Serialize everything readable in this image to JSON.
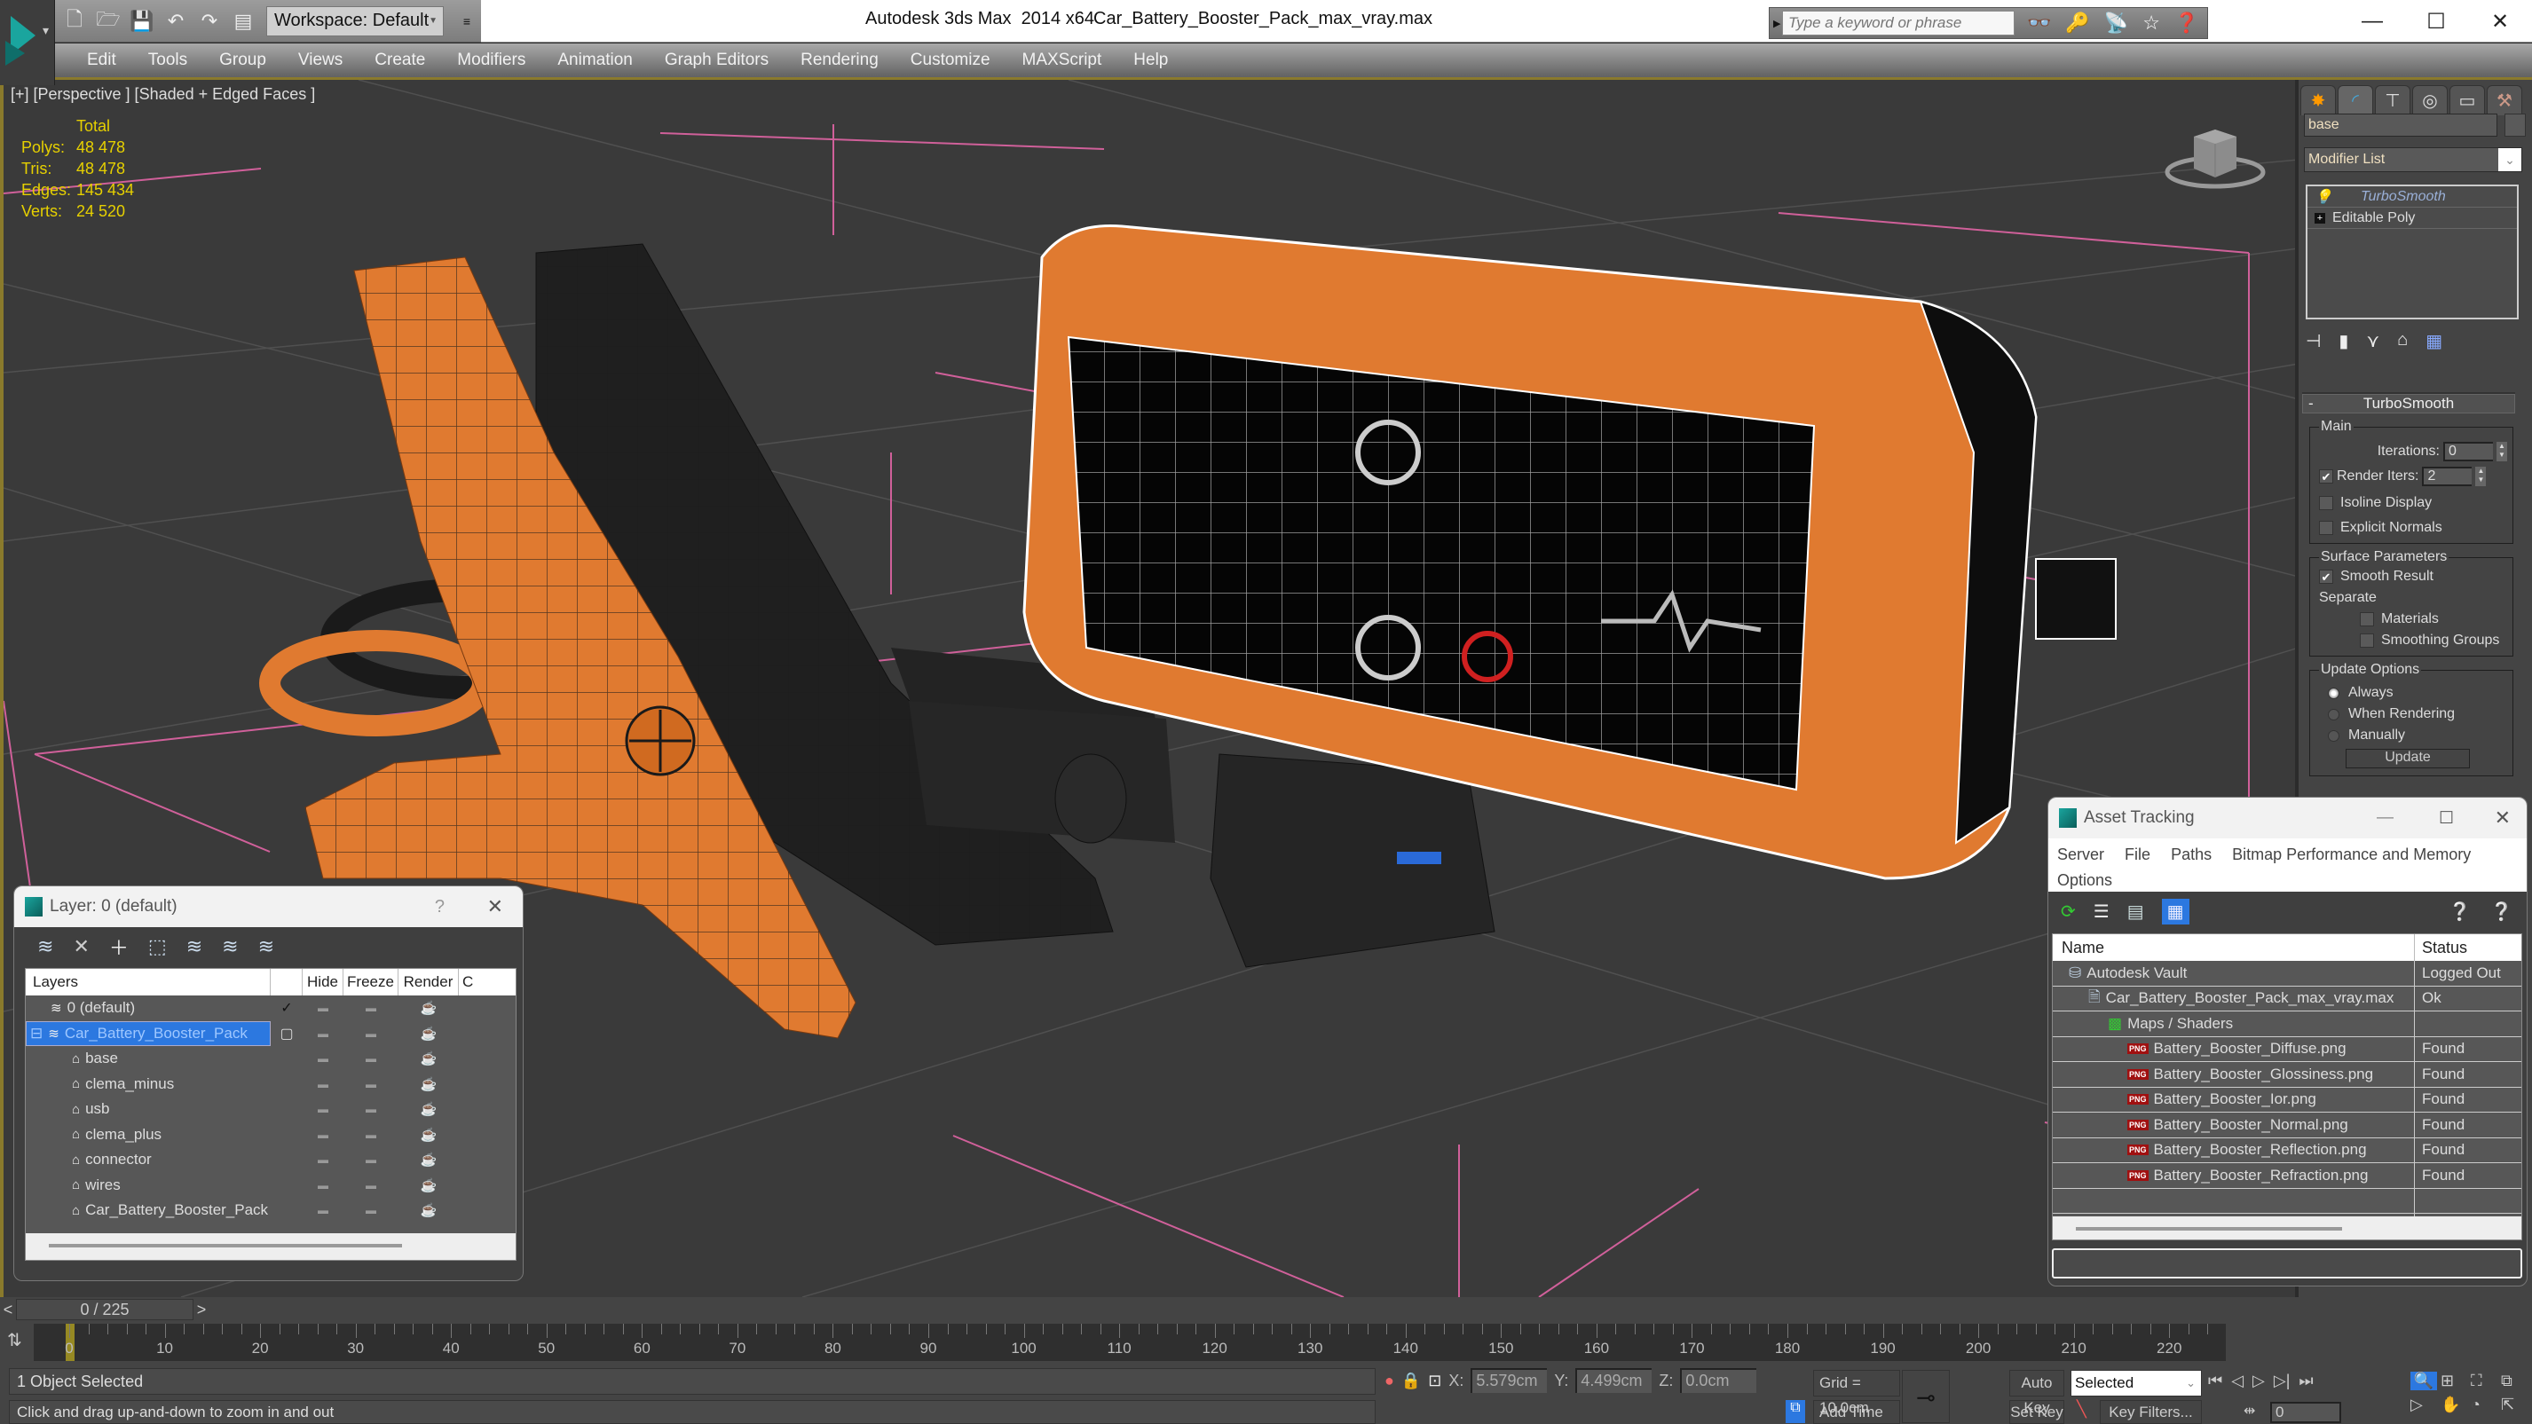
{
  "window": {
    "app_title": "Autodesk 3ds Max  2014 x64",
    "file_name": "Car_Battery_Booster_Pack_max_vray.max",
    "workspace": "Workspace: Default",
    "search_placeholder": "Type a keyword or phrase",
    "controls": {
      "minimize": "—",
      "maximize": "☐",
      "close": "✕"
    }
  },
  "quick_access": [
    "new-file-icon",
    "open-file-icon",
    "save-icon",
    "undo-icon",
    "redo-icon",
    "project-folder-icon"
  ],
  "menu": [
    "Edit",
    "Tools",
    "Group",
    "Views",
    "Create",
    "Modifiers",
    "Animation",
    "Graph Editors",
    "Rendering",
    "Customize",
    "MAXScript",
    "Help"
  ],
  "viewport": {
    "label": "[+] [Perspective ] [Shaded + Edged Faces ]",
    "stats": {
      "header": "Total",
      "rows": [
        {
          "key": "Polys:",
          "value": "48 478"
        },
        {
          "key": "Tris:",
          "value": "48 478"
        },
        {
          "key": "Edges:",
          "value": "145 434"
        },
        {
          "key": "Verts:",
          "value": "24 520"
        }
      ]
    },
    "colors": {
      "orange": "#e07a30",
      "black_part": "#1e1e1e",
      "grid_line": "#d0609a",
      "stats_text": "#e6d000"
    }
  },
  "command_panel": {
    "object_name": "base",
    "modifier_list": "Modifier List",
    "stack": [
      "TurboSmooth",
      "Editable Poly"
    ],
    "rollout_title": "TurboSmooth",
    "main": {
      "legend": "Main",
      "iterations_label": "Iterations:",
      "iterations_value": "0",
      "render_iters_label": "Render Iters:",
      "render_iters_value": "2",
      "render_iters_checked": true,
      "isoline_label": "Isoline Display",
      "isoline_checked": false,
      "explicit_label": "Explicit Normals",
      "explicit_checked": false
    },
    "surface": {
      "legend": "Surface Parameters",
      "smooth_result_label": "Smooth Result",
      "smooth_result_checked": true,
      "separate_label": "Separate",
      "materials_label": "Materials",
      "smoothing_groups_label": "Smoothing Groups"
    },
    "update": {
      "legend": "Update Options",
      "options": [
        "Always",
        "When Rendering",
        "Manually"
      ],
      "selected": "Always",
      "button": "Update"
    }
  },
  "layer_dialog": {
    "title": "Layer: 0 (default)",
    "help": "?",
    "close": "✕",
    "columns": [
      "Layers",
      "",
      "Hide",
      "Freeze",
      "Render",
      "C"
    ],
    "rows": [
      {
        "name": "0 (default)",
        "type": "layer",
        "current": true,
        "selected": false,
        "indent": 1
      },
      {
        "name": "Car_Battery_Booster_Pack",
        "type": "layer",
        "current": false,
        "selected": true,
        "indent": 0
      },
      {
        "name": "base",
        "type": "object",
        "indent": 2
      },
      {
        "name": "clema_minus",
        "type": "object",
        "indent": 2
      },
      {
        "name": "usb",
        "type": "object",
        "indent": 2
      },
      {
        "name": "clema_plus",
        "type": "object",
        "indent": 2
      },
      {
        "name": "connector",
        "type": "object",
        "indent": 2
      },
      {
        "name": "wires",
        "type": "object",
        "indent": 2
      },
      {
        "name": "Car_Battery_Booster_Pack",
        "type": "object",
        "indent": 2
      }
    ]
  },
  "asset_tracking": {
    "title": "Asset Tracking",
    "menu": [
      "Server",
      "File",
      "Paths",
      "Bitmap Performance and Memory",
      "Options"
    ],
    "columns": [
      "Name",
      "Status"
    ],
    "rows": [
      {
        "name": "Autodesk Vault",
        "status": "Logged Out",
        "icon": "vault-icon",
        "indent": 1
      },
      {
        "name": "Car_Battery_Booster_Pack_max_vray.max",
        "status": "Ok",
        "icon": "max-file-icon",
        "indent": 2
      },
      {
        "name": "Maps / Shaders",
        "status": "",
        "icon": "maps-icon",
        "indent": 3
      },
      {
        "name": "Battery_Booster_Diffuse.png",
        "status": "Found",
        "icon": "png-icon",
        "indent": 4
      },
      {
        "name": "Battery_Booster_Glossiness.png",
        "status": "Found",
        "icon": "png-icon",
        "indent": 4
      },
      {
        "name": "Battery_Booster_Ior.png",
        "status": "Found",
        "icon": "png-icon",
        "indent": 4
      },
      {
        "name": "Battery_Booster_Normal.png",
        "status": "Found",
        "icon": "png-icon",
        "indent": 4
      },
      {
        "name": "Battery_Booster_Reflection.png",
        "status": "Found",
        "icon": "png-icon",
        "indent": 4
      },
      {
        "name": "Battery_Booster_Refraction.png",
        "status": "Found",
        "icon": "png-icon",
        "indent": 4
      }
    ]
  },
  "timeline": {
    "frame_display": "0 / 225",
    "current_frame": 0,
    "total_frames": 225,
    "tick_labels": [
      0,
      10,
      20,
      30,
      40,
      50,
      60,
      70,
      80,
      90,
      100,
      110,
      120,
      130,
      140,
      150,
      160,
      170,
      180,
      190,
      200,
      210,
      220
    ]
  },
  "status": {
    "selection": "1 Object Selected",
    "prompt": "Click and drag up-and-down to zoom in and out",
    "x_label": "X:",
    "x": "5.579cm",
    "y_label": "Y:",
    "y": "4.499cm",
    "z_label": "Z:",
    "z": "0.0cm",
    "grid": "Grid = 10.0cm",
    "add_time_tag": "Add Time Tag",
    "auto_key": "Auto Key",
    "set_key": "Set Key",
    "key_mode": "Selected",
    "key_filters": "Key Filters...",
    "frame_field": "0"
  }
}
